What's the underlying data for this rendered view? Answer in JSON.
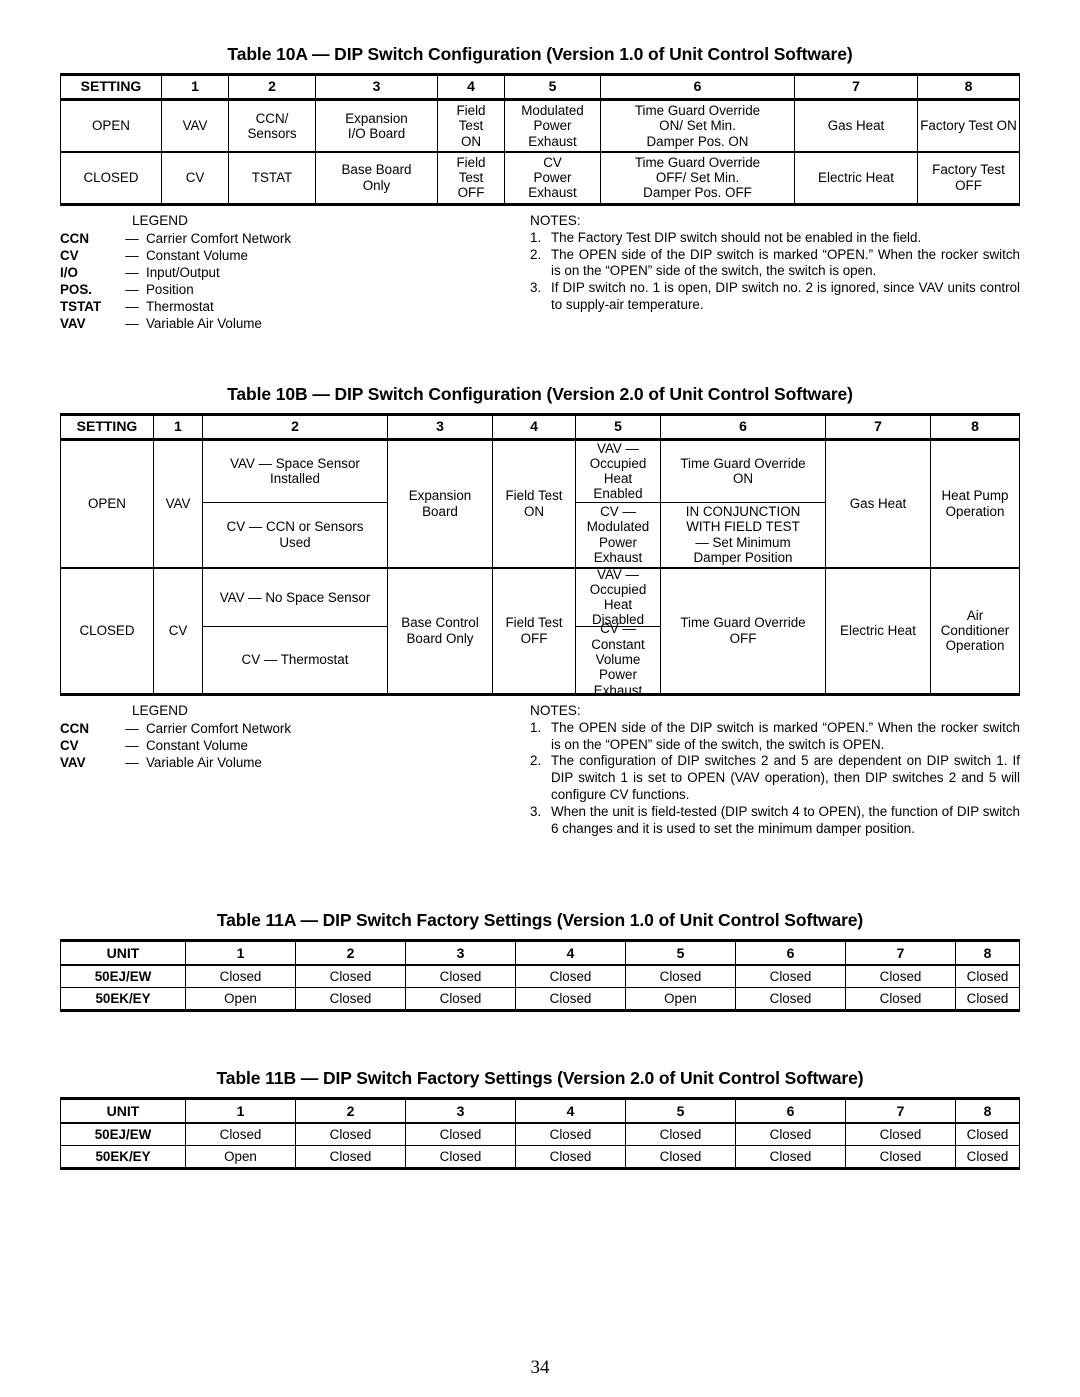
{
  "page": {
    "number": "34"
  },
  "table10A": {
    "title": "Table 10A — DIP Switch Configuration (Version 1.0 of Unit Control Software)",
    "header": [
      "SETTING",
      "1",
      "2",
      "3",
      "4",
      "5",
      "6",
      "7",
      "8"
    ],
    "rows": [
      {
        "setting": "OPEN",
        "cells": [
          "VAV",
          "CCN/\nSensors",
          "Expansion\nI/O Board",
          "Field\nTest\nON",
          "Modulated\nPower\nExhaust",
          "Time Guard Override\nON/ Set Min.\nDamper Pos. ON",
          "Gas Heat",
          "Factory Test ON"
        ]
      },
      {
        "setting": "CLOSED",
        "cells": [
          "CV",
          "TSTAT",
          "Base Board\nOnly",
          "Field\nTest\nOFF",
          "CV\nPower\nExhaust",
          "Time Guard Override\nOFF/ Set Min.\nDamper Pos. OFF",
          "Electric Heat",
          "Factory Test OFF"
        ]
      }
    ],
    "legend": {
      "heading": "LEGEND",
      "entries": [
        {
          "abbr": "CCN",
          "dash": "—",
          "meaning": "Carrier Comfort Network"
        },
        {
          "abbr": "CV",
          "dash": "—",
          "meaning": "Constant Volume"
        },
        {
          "abbr": "I/O",
          "dash": "—",
          "meaning": "Input/Output"
        },
        {
          "abbr": "POS.",
          "dash": "—",
          "meaning": "Position"
        },
        {
          "abbr": "TSTAT",
          "dash": "—",
          "meaning": "Thermostat"
        },
        {
          "abbr": "VAV",
          "dash": "—",
          "meaning": "Variable Air Volume"
        }
      ]
    },
    "notes": {
      "heading": "NOTES:",
      "items": [
        {
          "num": "1.",
          "text": "The Factory Test DIP switch should not be enabled in the field."
        },
        {
          "num": "2.",
          "text": "The OPEN side of the DIP switch is marked “OPEN.” When the rocker switch is on the “OPEN” side of the switch, the switch is open."
        },
        {
          "num": "3.",
          "text": "If DIP switch no. 1 is open, DIP switch no. 2 is ignored, since VAV units control to supply-air temperature."
        }
      ]
    }
  },
  "table10B": {
    "title": "Table 10B — DIP Switch Configuration (Version 2.0 of Unit Control Software)",
    "header": [
      "SETTING",
      "1",
      "2",
      "3",
      "4",
      "5",
      "6",
      "7",
      "8"
    ],
    "open": {
      "setting": "OPEN",
      "col1": "VAV",
      "col2_top": "VAV — Space Sensor\nInstalled",
      "col2_bottom": "CV — CCN or Sensors\nUsed",
      "col3": "Expansion\nBoard",
      "col4": "Field Test\nON",
      "col5_top": "VAV —\nOccupied\nHeat\nEnabled",
      "col5_bottom": "CV —\nModulated\nPower\nExhaust",
      "col6_top": "Time Guard Override\nON",
      "col6_bottom": "IN CONJUNCTION\nWITH FIELD TEST\n— Set Minimum\nDamper Position",
      "col7": "Gas Heat",
      "col8": "Heat Pump\nOperation"
    },
    "closed": {
      "setting": "CLOSED",
      "col1": "CV",
      "col2_top": "VAV — No Space Sensor",
      "col2_bottom": "CV — Thermostat",
      "col3": "Base Control\nBoard Only",
      "col4": "Field Test\nOFF",
      "col5_top": "VAV —\nOccupied\nHeat\nDisabled",
      "col5_bottom": "CV —\nConstant\nVolume\nPower\nExhaust",
      "col6": "Time Guard Override\nOFF",
      "col7": "Electric Heat",
      "col8": "Air Conditioner\nOperation"
    },
    "legend": {
      "heading": "LEGEND",
      "entries": [
        {
          "abbr": "CCN",
          "dash": "—",
          "meaning": "Carrier Comfort Network"
        },
        {
          "abbr": "CV",
          "dash": "—",
          "meaning": "Constant Volume"
        },
        {
          "abbr": "VAV",
          "dash": "—",
          "meaning": "Variable Air Volume"
        }
      ]
    },
    "notes": {
      "heading": "NOTES:",
      "items": [
        {
          "num": "1.",
          "text": "The OPEN side of the DIP switch is marked “OPEN.” When the rocker switch is on the “OPEN” side of the switch, the switch is OPEN."
        },
        {
          "num": "2.",
          "text": "The configuration of DIP switches 2 and 5 are dependent on DIP switch 1. If DIP switch 1 is set to OPEN (VAV operation), then DIP switches 2 and 5 will configure CV functions."
        },
        {
          "num": "3.",
          "text": "When the unit is field-tested (DIP switch 4 to OPEN), the function of DIP switch 6 changes and it is used to set the minimum damper position."
        }
      ]
    }
  },
  "table11A": {
    "title": "Table 11A — DIP Switch Factory Settings (Version 1.0 of Unit Control Software)",
    "header": [
      "UNIT",
      "1",
      "2",
      "3",
      "4",
      "5",
      "6",
      "7",
      "8"
    ],
    "rows": [
      {
        "unit": "50EJ/EW",
        "values": [
          "Closed",
          "Closed",
          "Closed",
          "Closed",
          "Closed",
          "Closed",
          "Closed",
          "Closed"
        ]
      },
      {
        "unit": "50EK/EY",
        "values": [
          "Open",
          "Closed",
          "Closed",
          "Closed",
          "Open",
          "Closed",
          "Closed",
          "Closed"
        ]
      }
    ]
  },
  "table11B": {
    "title": "Table 11B — DIP Switch Factory Settings (Version 2.0 of Unit Control Software)",
    "header": [
      "UNIT",
      "1",
      "2",
      "3",
      "4",
      "5",
      "6",
      "7",
      "8"
    ],
    "rows": [
      {
        "unit": "50EJ/EW",
        "values": [
          "Closed",
          "Closed",
          "Closed",
          "Closed",
          "Closed",
          "Closed",
          "Closed",
          "Closed"
        ]
      },
      {
        "unit": "50EK/EY",
        "values": [
          "Open",
          "Closed",
          "Closed",
          "Closed",
          "Closed",
          "Closed",
          "Closed",
          "Closed"
        ]
      }
    ]
  }
}
